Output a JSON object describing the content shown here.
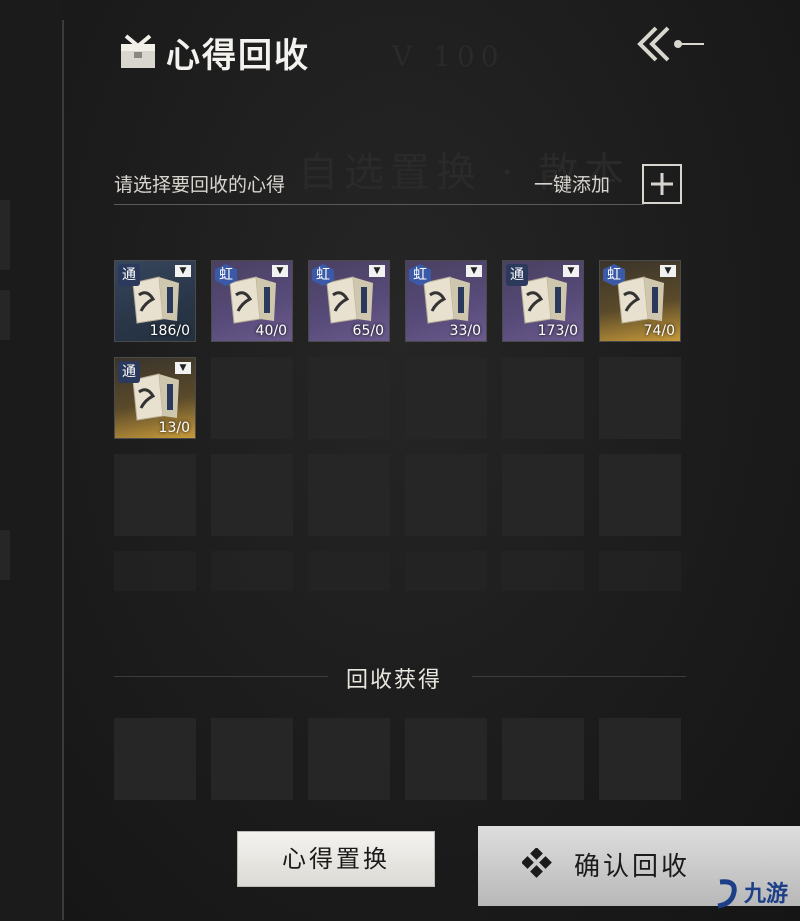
{
  "header": {
    "title": "心得回收",
    "title_icon": "chest-icon",
    "back_icon": "back-arrow-icon"
  },
  "background_ghost": {
    "line1": "V 100",
    "line2": "自选置换 · 散本"
  },
  "selection": {
    "prompt": "请选择要回收的心得",
    "add_all_label": "一键添加",
    "add_icon": "plus-icon"
  },
  "items": [
    {
      "tag": "通",
      "rarity": "tong",
      "frame": "common-blue",
      "qty": "186/0"
    },
    {
      "tag": "虹",
      "rarity": "hong",
      "frame": "rainbow",
      "qty": "40/0"
    },
    {
      "tag": "虹",
      "rarity": "hong",
      "frame": "rainbow",
      "qty": "65/0"
    },
    {
      "tag": "虹",
      "rarity": "hong",
      "frame": "rainbow",
      "qty": "33/0"
    },
    {
      "tag": "通",
      "rarity": "tong",
      "frame": "rainbow",
      "qty": "173/0"
    },
    {
      "tag": "虹",
      "rarity": "hong",
      "frame": "gold",
      "qty": "74/0"
    },
    {
      "tag": "通",
      "rarity": "tong",
      "frame": "gold",
      "qty": "13/0"
    }
  ],
  "rewards": {
    "title": "回收获得"
  },
  "buttons": {
    "replace_label": "心得置换",
    "confirm_label": "确认回收",
    "confirm_icon": "diamond-cluster-icon"
  },
  "watermark": {
    "text": "九游",
    "icon": "jiuyou-logo-icon"
  },
  "colors": {
    "background": "#1a1a1a",
    "slot": "#262626",
    "text": "#e9e6df",
    "rainbow_frame": "#564a78",
    "gold_frame": "#c89a3a",
    "common_frame": "#2a3648"
  }
}
